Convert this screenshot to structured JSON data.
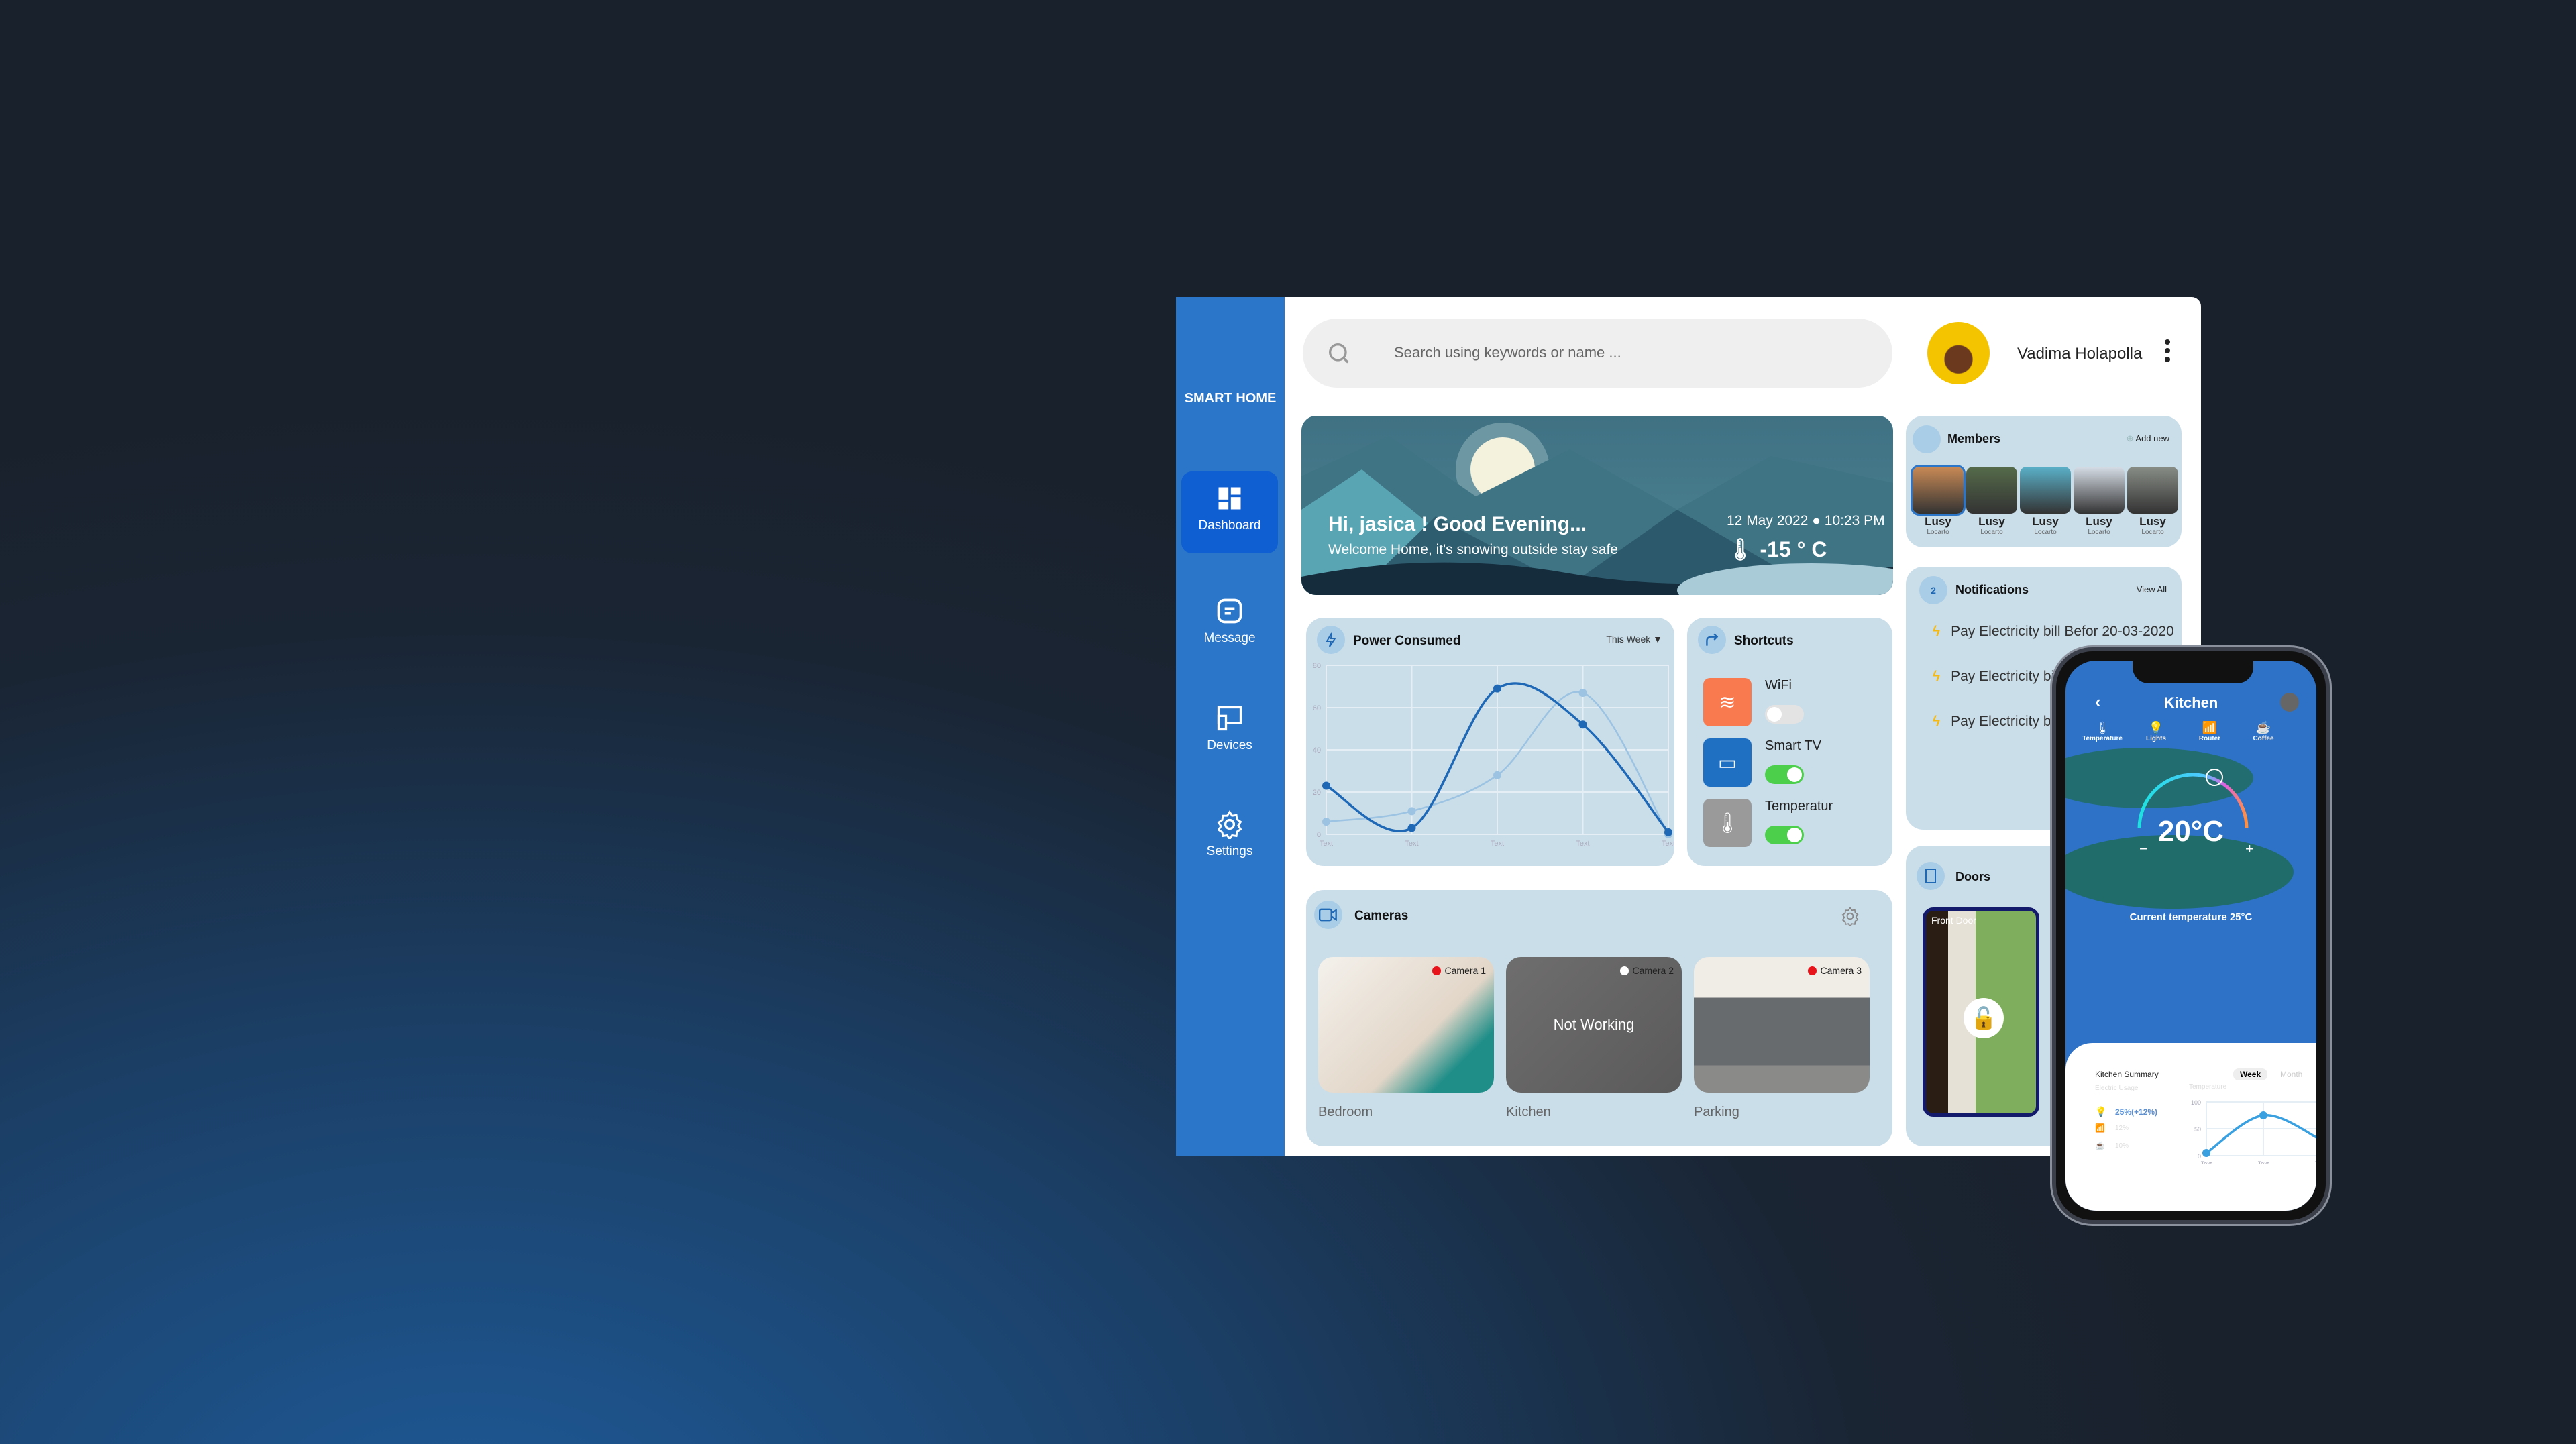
{
  "sidebar": {
    "brand": "SMART HOME",
    "items": [
      {
        "label": "Dashboard",
        "icon": "dashboard-icon",
        "active": true
      },
      {
        "label": "Message",
        "icon": "message-icon"
      },
      {
        "label": "Devices",
        "icon": "devices-icon"
      },
      {
        "label": "Settings",
        "icon": "gear-icon"
      }
    ]
  },
  "header": {
    "search_placeholder": "Search using keywords or name ...",
    "user_name": "Vadima Holapolla"
  },
  "hero": {
    "greeting": "Hi, jasica ! Good Evening...",
    "subtitle": "Welcome Home, it's snowing outside stay safe",
    "date": "12 May 2022",
    "time": "10:23 PM",
    "temperature": "-15 ° C"
  },
  "power": {
    "title": "Power Consumed",
    "period": "This Week"
  },
  "chart_data": {
    "type": "line",
    "x": [
      "Text",
      "Text",
      "Text",
      "Text",
      "Text"
    ],
    "ylim": [
      0,
      80
    ],
    "yticks": [
      0,
      20,
      40,
      60,
      80
    ],
    "grid": true,
    "series": [
      {
        "values": [
          23,
          3,
          69,
          52,
          1
        ],
        "color": "#1f68b5"
      },
      {
        "values": [
          6,
          11,
          28,
          67,
          0
        ],
        "color": "#9cc3e2"
      }
    ]
  },
  "shortcuts": {
    "title": "Shortcuts",
    "items": [
      {
        "label": "WiFi",
        "on": false,
        "color": "#f97a4e"
      },
      {
        "label": "Smart TV",
        "on": true,
        "color": "#1f6fc2"
      },
      {
        "label": "Temperatur",
        "on": true,
        "color": "#9a9a9a"
      }
    ]
  },
  "cameras": {
    "title": "Cameras",
    "items": [
      {
        "badge": "Camera 1",
        "status": "#e8141b",
        "name": "Bedroom"
      },
      {
        "badge": "Camera 2",
        "status": "#ffffff",
        "name": "Kitchen",
        "overlay": "Not Working"
      },
      {
        "badge": "Camera 3",
        "status": "#e8141b",
        "name": "Parking"
      }
    ]
  },
  "members": {
    "title": "Members",
    "add_label": "Add new",
    "items": [
      {
        "name": "Lusy",
        "sub": "Locarto"
      },
      {
        "name": "Lusy",
        "sub": "Locarto"
      },
      {
        "name": "Lusy",
        "sub": "Locarto"
      },
      {
        "name": "Lusy",
        "sub": "Locarto"
      },
      {
        "name": "Lusy",
        "sub": "Locarto"
      }
    ]
  },
  "notifications": {
    "title": "Notifications",
    "count": "2",
    "view_all": "View All",
    "items": [
      "Pay Electricity bill Befor 20-03-2020",
      "Pay Electricity bill Befor 20-03-2020",
      "Pay Electricity bill Befor 20-03-2020"
    ]
  },
  "doors": {
    "title": "Doors",
    "front_label": "Front Door"
  },
  "phone": {
    "title": "Kitchen",
    "devices": [
      "Temperature",
      "Lights",
      "Router",
      "Coffee"
    ],
    "set_temp": "20°C",
    "current": "Current temperature 25°C",
    "summary_title": "Kitchen Summary",
    "tab_week": "Week",
    "tab_month": "Month",
    "usage_label": "Electric Usage",
    "temp_label": "Temperature",
    "usage": [
      "25%(+12%)",
      "12%",
      "10%"
    ],
    "chart_data": {
      "type": "line",
      "x": [
        "Text",
        "Text",
        "Text"
      ],
      "ylim": [
        0,
        100
      ],
      "yticks": [
        0,
        50,
        100
      ],
      "values": [
        5,
        75,
        30
      ]
    }
  }
}
